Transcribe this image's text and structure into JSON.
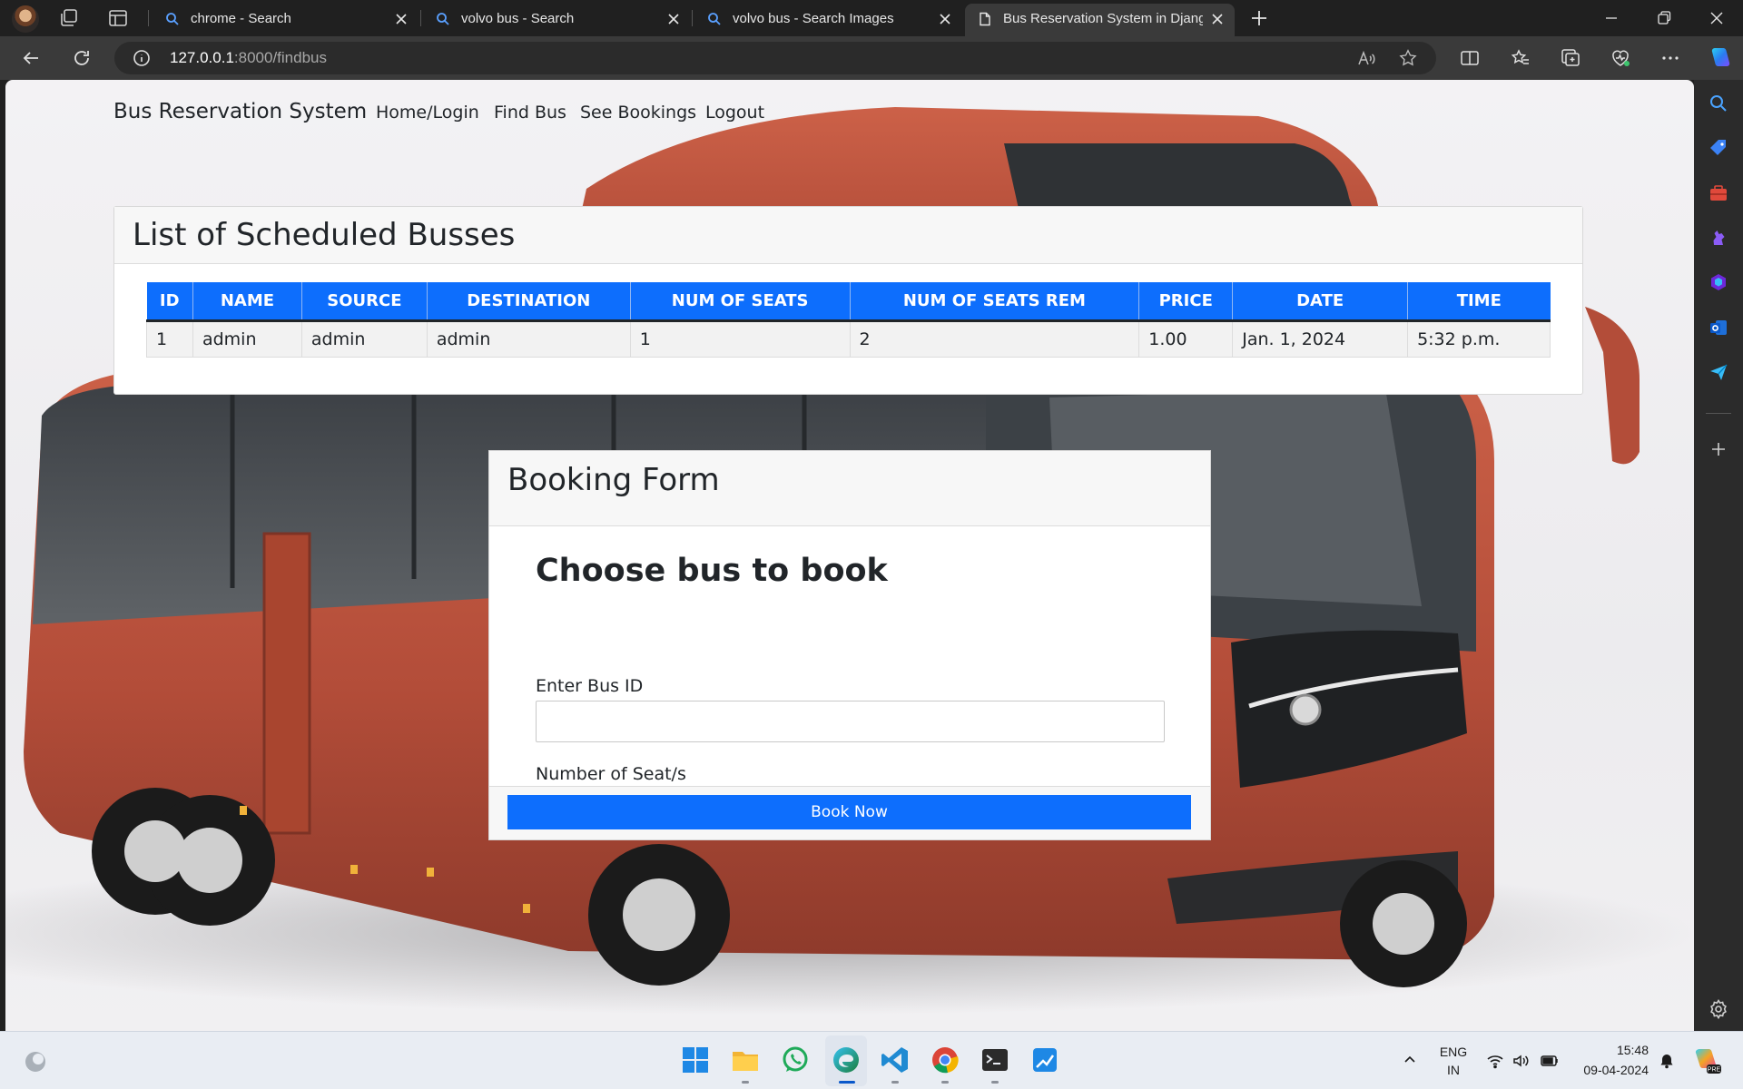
{
  "browser": {
    "tabs": [
      {
        "title": "chrome - Search",
        "icon": "search-icon"
      },
      {
        "title": "volvo bus - Search",
        "icon": "search-icon"
      },
      {
        "title": "volvo bus - Search Images",
        "icon": "search-icon"
      },
      {
        "title": "Bus Reservation System in Djang",
        "icon": "page-icon",
        "active": true
      }
    ],
    "url": {
      "host": "127.0.0.1",
      "path": ":8000/findbus"
    }
  },
  "site": {
    "brand": "Bus Reservation System",
    "nav": [
      "Home/Login",
      "Find Bus",
      "See Bookings",
      "Logout"
    ]
  },
  "buses": {
    "title": "List of Scheduled Busses",
    "columns": [
      "ID",
      "NAME",
      "SOURCE",
      "DESTINATION",
      "NUM OF SEATS",
      "NUM OF SEATS REM",
      "PRICE",
      "DATE",
      "TIME"
    ],
    "rows": [
      [
        "1",
        "admin",
        "admin",
        "admin",
        "1",
        "2",
        "1.00",
        "Jan. 1, 2024",
        "5:32 p.m."
      ]
    ]
  },
  "booking": {
    "title": "Booking Form",
    "heading": "Choose bus to book",
    "bus_id_label": "Enter Bus ID",
    "bus_id_value": "",
    "seats_label": "Number of Seat/s",
    "seats_value": "",
    "submit": "Book Now"
  },
  "taskbar": {
    "apps": [
      "windows-start-icon",
      "file-explorer-icon",
      "whatsapp-icon",
      "edge-icon",
      "vscode-icon",
      "chrome-icon",
      "terminal-icon",
      "paint-icon"
    ],
    "lang_top": "ENG",
    "lang_bottom": "IN",
    "time": "15:48",
    "date": "09-04-2024"
  },
  "colors": {
    "primary": "#0d6efd",
    "bus_body": "#b9533e"
  }
}
